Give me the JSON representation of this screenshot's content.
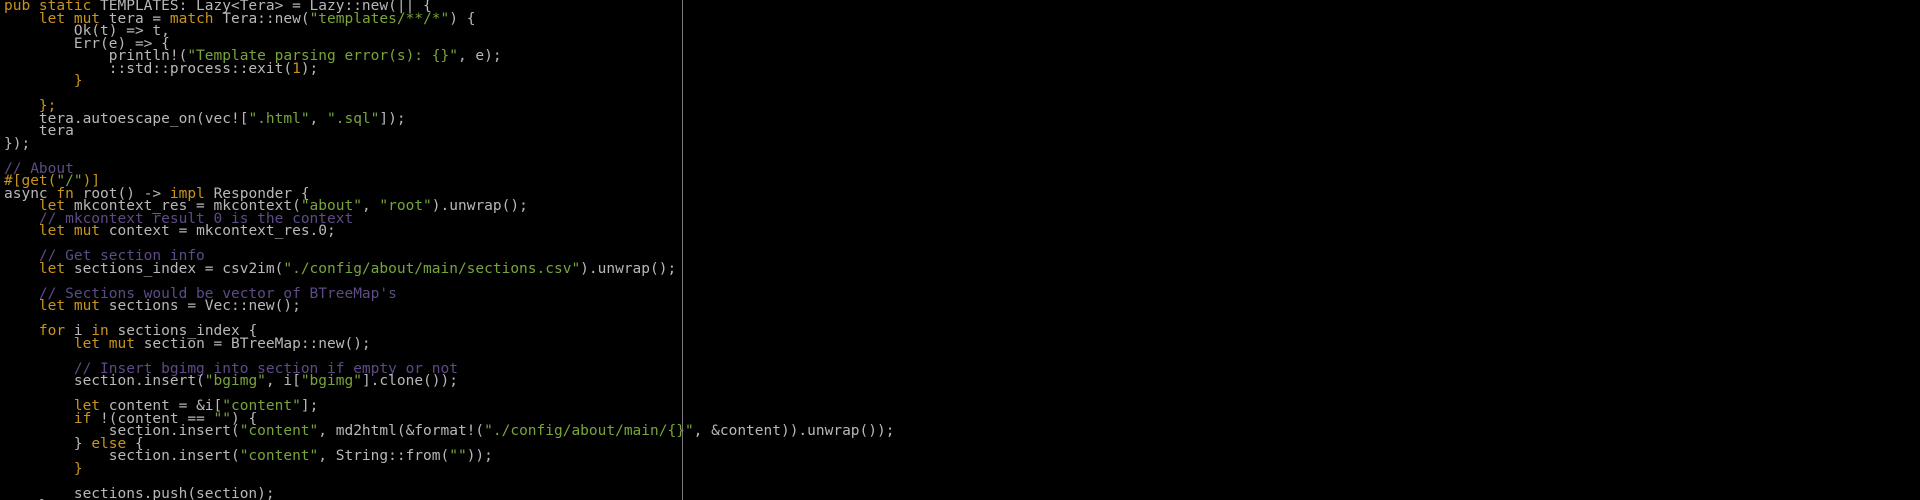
{
  "colors": {
    "background": "#000000",
    "default_text": "#b8b8b8",
    "keyword": "#c8941e",
    "string": "#78a53a",
    "comment": "#5e4b86",
    "attribute": "#c8941e",
    "color_column": "#7a7a7a"
  },
  "code_lines": [
    [
      {
        "t": "kw",
        "v": "pub static "
      },
      {
        "t": "txt",
        "v": "TEMPLATES: Lazy<Tera> = Lazy::new(|| {"
      }
    ],
    [
      {
        "t": "txt",
        "v": "    "
      },
      {
        "t": "kw",
        "v": "let mut "
      },
      {
        "t": "txt",
        "v": "tera = "
      },
      {
        "t": "kw",
        "v": "match "
      },
      {
        "t": "txt",
        "v": "Tera::new("
      },
      {
        "t": "str",
        "v": "\"templates/**/*\""
      },
      {
        "t": "txt",
        "v": ") {"
      }
    ],
    [
      {
        "t": "txt",
        "v": "        Ok(t) => t,"
      }
    ],
    [
      {
        "t": "txt",
        "v": "        Err(e) => {"
      }
    ],
    [
      {
        "t": "txt",
        "v": "            println!("
      },
      {
        "t": "str",
        "v": "\"Template parsing error(s): {}\""
      },
      {
        "t": "txt",
        "v": ", e);"
      }
    ],
    [
      {
        "t": "txt",
        "v": "            ::std::process::exit("
      },
      {
        "t": "kw",
        "v": "1"
      },
      {
        "t": "txt",
        "v": ");"
      }
    ],
    [
      {
        "t": "kw",
        "v": "        }"
      }
    ],
    [
      {
        "t": "txt",
        "v": ""
      }
    ],
    [
      {
        "t": "kw",
        "v": "    };"
      }
    ],
    [
      {
        "t": "txt",
        "v": "    tera.autoescape_on(vec!["
      },
      {
        "t": "str",
        "v": "\".html\""
      },
      {
        "t": "txt",
        "v": ", "
      },
      {
        "t": "str",
        "v": "\".sql\""
      },
      {
        "t": "txt",
        "v": "]);"
      }
    ],
    [
      {
        "t": "txt",
        "v": "    tera"
      }
    ],
    [
      {
        "t": "txt",
        "v": "});"
      }
    ],
    [
      {
        "t": "txt",
        "v": ""
      }
    ],
    [
      {
        "t": "cm",
        "v": "// About"
      }
    ],
    [
      {
        "t": "attr",
        "v": "#[get("
      },
      {
        "t": "str",
        "v": "\"/\""
      },
      {
        "t": "attr",
        "v": ")]"
      }
    ],
    [
      {
        "t": "txt",
        "v": "async "
      },
      {
        "t": "kw",
        "v": "fn "
      },
      {
        "t": "txt",
        "v": "root() -> "
      },
      {
        "t": "kw",
        "v": "impl "
      },
      {
        "t": "txt",
        "v": "Responder {"
      }
    ],
    [
      {
        "t": "txt",
        "v": "    "
      },
      {
        "t": "kw",
        "v": "let "
      },
      {
        "t": "txt",
        "v": "mkcontext_res = mkcontext("
      },
      {
        "t": "str",
        "v": "\"about\""
      },
      {
        "t": "txt",
        "v": ", "
      },
      {
        "t": "str",
        "v": "\"root\""
      },
      {
        "t": "txt",
        "v": ").unwrap();"
      }
    ],
    [
      {
        "t": "txt",
        "v": "    "
      },
      {
        "t": "cm",
        "v": "// mkcontext result 0 is the context"
      }
    ],
    [
      {
        "t": "txt",
        "v": "    "
      },
      {
        "t": "kw",
        "v": "let mut "
      },
      {
        "t": "txt",
        "v": "context = mkcontext_res.0;"
      }
    ],
    [
      {
        "t": "txt",
        "v": ""
      }
    ],
    [
      {
        "t": "txt",
        "v": "    "
      },
      {
        "t": "cm",
        "v": "// Get section info"
      }
    ],
    [
      {
        "t": "txt",
        "v": "    "
      },
      {
        "t": "kw",
        "v": "let "
      },
      {
        "t": "txt",
        "v": "sections_index = csv2im("
      },
      {
        "t": "str",
        "v": "\"./config/about/main/sections.csv\""
      },
      {
        "t": "txt",
        "v": ").unwrap();"
      }
    ],
    [
      {
        "t": "txt",
        "v": ""
      }
    ],
    [
      {
        "t": "txt",
        "v": "    "
      },
      {
        "t": "cm",
        "v": "// Sections would be vector of BTreeMap's"
      }
    ],
    [
      {
        "t": "txt",
        "v": "    "
      },
      {
        "t": "kw",
        "v": "let mut "
      },
      {
        "t": "txt",
        "v": "sections = Vec::new();"
      }
    ],
    [
      {
        "t": "txt",
        "v": ""
      }
    ],
    [
      {
        "t": "txt",
        "v": "    "
      },
      {
        "t": "kw",
        "v": "for "
      },
      {
        "t": "txt",
        "v": "i "
      },
      {
        "t": "kw",
        "v": "in "
      },
      {
        "t": "txt",
        "v": "sections_index {"
      }
    ],
    [
      {
        "t": "txt",
        "v": "        "
      },
      {
        "t": "kw",
        "v": "let mut "
      },
      {
        "t": "txt",
        "v": "section = BTreeMap::new();"
      }
    ],
    [
      {
        "t": "txt",
        "v": ""
      }
    ],
    [
      {
        "t": "txt",
        "v": "        "
      },
      {
        "t": "cm",
        "v": "// Insert bgimg into section if empty or not"
      }
    ],
    [
      {
        "t": "txt",
        "v": "        section.insert("
      },
      {
        "t": "str",
        "v": "\"bgimg\""
      },
      {
        "t": "txt",
        "v": ", i["
      },
      {
        "t": "str",
        "v": "\"bgimg\""
      },
      {
        "t": "txt",
        "v": "].clone());"
      }
    ],
    [
      {
        "t": "txt",
        "v": ""
      }
    ],
    [
      {
        "t": "txt",
        "v": "        "
      },
      {
        "t": "kw",
        "v": "let "
      },
      {
        "t": "txt",
        "v": "content = &i["
      },
      {
        "t": "str",
        "v": "\"content\""
      },
      {
        "t": "txt",
        "v": "];"
      }
    ],
    [
      {
        "t": "txt",
        "v": "        "
      },
      {
        "t": "kw",
        "v": "if "
      },
      {
        "t": "txt",
        "v": "!(content == "
      },
      {
        "t": "str",
        "v": "\"\""
      },
      {
        "t": "txt",
        "v": ") {"
      }
    ],
    [
      {
        "t": "txt",
        "v": "            section.insert("
      },
      {
        "t": "str",
        "v": "\"content\""
      },
      {
        "t": "txt",
        "v": ", md2html(&format!("
      },
      {
        "t": "str",
        "v": "\"./config/about/main/{}\""
      },
      {
        "t": "txt",
        "v": ", &content)).unwrap());"
      }
    ],
    [
      {
        "t": "txt",
        "v": "        } "
      },
      {
        "t": "kw",
        "v": "else "
      },
      {
        "t": "txt",
        "v": "{"
      }
    ],
    [
      {
        "t": "txt",
        "v": "            section.insert("
      },
      {
        "t": "str",
        "v": "\"content\""
      },
      {
        "t": "txt",
        "v": ", String::from("
      },
      {
        "t": "str",
        "v": "\"\""
      },
      {
        "t": "txt",
        "v": "));"
      }
    ],
    [
      {
        "t": "kw",
        "v": "        }"
      }
    ],
    [
      {
        "t": "txt",
        "v": ""
      }
    ],
    [
      {
        "t": "txt",
        "v": "        sections.push(section);"
      }
    ],
    [
      {
        "t": "txt",
        "v": "    }"
      }
    ]
  ]
}
